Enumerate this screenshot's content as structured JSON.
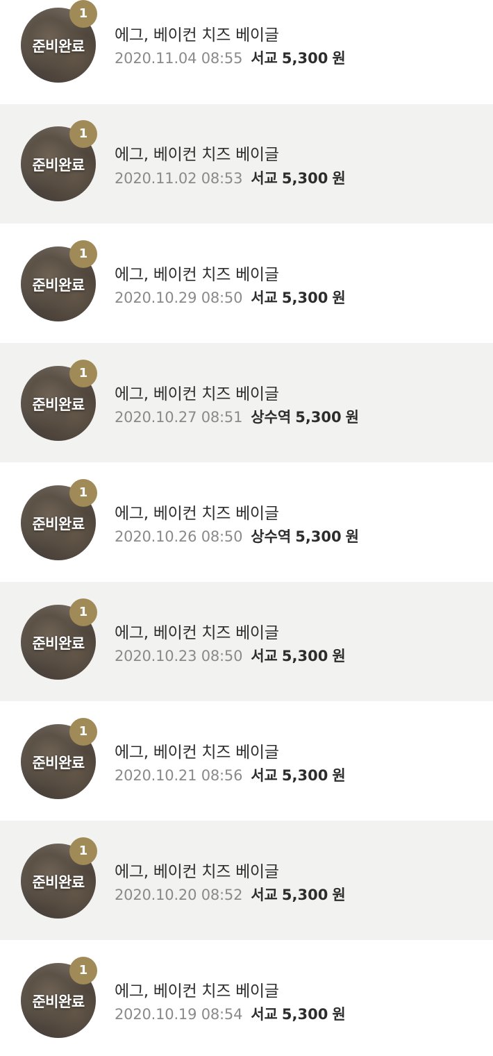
{
  "orders": [
    {
      "status": "준비완료",
      "qty": "1",
      "item": "에그, 베이컨 치즈 베이글",
      "datetime": "2020.11.04 08:55",
      "store": "서교",
      "price": "5,300",
      "currency": "원"
    },
    {
      "status": "준비완료",
      "qty": "1",
      "item": "에그, 베이컨 치즈 베이글",
      "datetime": "2020.11.02 08:53",
      "store": "서교",
      "price": "5,300",
      "currency": "원"
    },
    {
      "status": "준비완료",
      "qty": "1",
      "item": "에그, 베이컨 치즈 베이글",
      "datetime": "2020.10.29 08:50",
      "store": "서교",
      "price": "5,300",
      "currency": "원"
    },
    {
      "status": "준비완료",
      "qty": "1",
      "item": "에그, 베이컨 치즈 베이글",
      "datetime": "2020.10.27 08:51",
      "store": "상수역",
      "price": "5,300",
      "currency": "원"
    },
    {
      "status": "준비완료",
      "qty": "1",
      "item": "에그, 베이컨 치즈 베이글",
      "datetime": "2020.10.26 08:50",
      "store": "상수역",
      "price": "5,300",
      "currency": "원"
    },
    {
      "status": "준비완료",
      "qty": "1",
      "item": "에그, 베이컨 치즈 베이글",
      "datetime": "2020.10.23 08:50",
      "store": "서교",
      "price": "5,300",
      "currency": "원"
    },
    {
      "status": "준비완료",
      "qty": "1",
      "item": "에그, 베이컨 치즈 베이글",
      "datetime": "2020.10.21 08:56",
      "store": "서교",
      "price": "5,300",
      "currency": "원"
    },
    {
      "status": "준비완료",
      "qty": "1",
      "item": "에그, 베이컨 치즈 베이글",
      "datetime": "2020.10.20 08:52",
      "store": "서교",
      "price": "5,300",
      "currency": "원"
    },
    {
      "status": "준비완료",
      "qty": "1",
      "item": "에그, 베이컨 치즈 베이글",
      "datetime": "2020.10.19 08:54",
      "store": "서교",
      "price": "5,300",
      "currency": "원"
    }
  ],
  "colors": {
    "badge": "#a08a57",
    "row_alt_background": "#f2f2f0",
    "text_primary": "#2d2d2d",
    "text_secondary": "#8a8a8a"
  }
}
